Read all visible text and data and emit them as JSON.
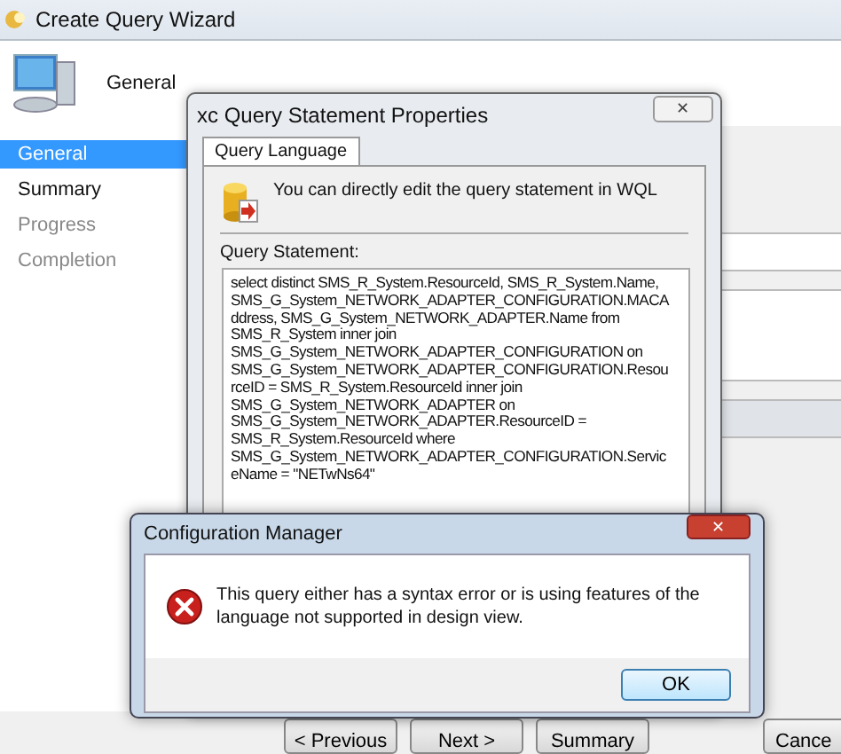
{
  "window": {
    "title": "Create Query Wizard"
  },
  "header": {
    "title": "General"
  },
  "sidebar": {
    "items": [
      {
        "label": "General",
        "selected": true,
        "disabled": false
      },
      {
        "label": "Summary",
        "selected": false,
        "disabled": false
      },
      {
        "label": "Progress",
        "selected": false,
        "disabled": true
      },
      {
        "label": "Completion",
        "selected": false,
        "disabled": true
      }
    ]
  },
  "footer_buttons": [
    {
      "label": "< Previous"
    },
    {
      "label": "Next >"
    },
    {
      "label": "Summary"
    },
    {
      "label": "Cance"
    }
  ],
  "properties_dialog": {
    "title": "xc Query Statement Properties",
    "close": "✕",
    "tabs": [
      {
        "label": "Query Language",
        "selected": true
      }
    ],
    "info": "You can directly edit the query statement in WQL",
    "field_label": "Query Statement:",
    "query": "select distinct SMS_R_System.ResourceId, SMS_R_System.Name, SMS_G_System_NETWORK_ADAPTER_CONFIGURATION.MACAddress, SMS_G_System_NETWORK_ADAPTER.Name from SMS_R_System inner join SMS_G_System_NETWORK_ADAPTER_CONFIGURATION on SMS_G_System_NETWORK_ADAPTER_CONFIGURATION.ResourceID = SMS_R_System.ResourceId inner join SMS_G_System_NETWORK_ADAPTER on SMS_G_System_NETWORK_ADAPTER.ResourceID = SMS_R_System.ResourceId where SMS_G_System_NETWORK_ADAPTER_CONFIGURATION.ServiceName = \"NETwNs64\""
  },
  "message_box": {
    "title": "Configuration Manager",
    "close": "✕",
    "message": "This query either has a syntax error or is using features of the language not supported in design view.",
    "buttons": [
      "OK"
    ]
  }
}
